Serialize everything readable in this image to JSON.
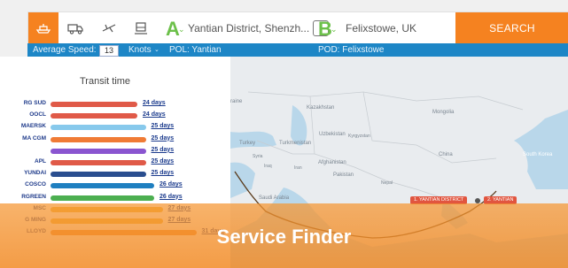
{
  "toolbar": {
    "modes": [
      {
        "icon": "ship-icon",
        "active": true
      },
      {
        "icon": "truck-icon",
        "active": false
      },
      {
        "icon": "plane-icon",
        "active": false
      },
      {
        "icon": "rail-icon",
        "active": false
      }
    ],
    "origin_letter": "A",
    "origin_value": "Yantian District, Shenzh...",
    "destination_letter": "B",
    "destination_value": "Felixstowe, UK",
    "search_label": "SEARCH",
    "accent_color": "#f58220",
    "route_color": "#6cc04a"
  },
  "infobar": {
    "speed_label": "Average Speed:",
    "speed_value": "13",
    "speed_unit": "Knots",
    "pol": "POL: Yantian",
    "pod": "POD: Felixstowe",
    "color": "#1d86c6"
  },
  "transit": {
    "title": "Transit time",
    "rows": [
      {
        "carrier": "RG SUD",
        "days": 24,
        "label": "24 days",
        "color": "#e05a48"
      },
      {
        "carrier": "OOCL",
        "days": 24,
        "label": "24 days",
        "color": "#e05a48"
      },
      {
        "carrier": "MAERSK",
        "days": 25,
        "label": "25 days",
        "color": "#87c9ec"
      },
      {
        "carrier": "MA CGM",
        "days": 25,
        "label": "25 days",
        "color": "#f07b35"
      },
      {
        "carrier": "",
        "days": 25,
        "label": "25 days",
        "color": "#8a55d0"
      },
      {
        "carrier": "APL",
        "days": 25,
        "label": "25 days",
        "color": "#e05a48"
      },
      {
        "carrier": "YUNDAI",
        "days": 25,
        "label": "25 days",
        "color": "#2a4e8f"
      },
      {
        "carrier": "COSCO",
        "days": 26,
        "label": "26 days",
        "color": "#1f7fc0"
      },
      {
        "carrier": "RGREEN",
        "days": 26,
        "label": "26 days",
        "color": "#4caf50"
      },
      {
        "carrier": "MSC",
        "days": 27,
        "label": "27 days",
        "color": "#f0b43a"
      },
      {
        "carrier": "G MING",
        "days": 27,
        "label": "27 days",
        "color": "#f0b43a"
      },
      {
        "carrier": "LLOYD",
        "days": 31,
        "label": "31 days",
        "color": "#f08a30"
      }
    ]
  },
  "map": {
    "labels": [
      "Kazakhstan",
      "Mongolia",
      "Uzbekistan",
      "Kyrgyzstan",
      "Turkey",
      "Turkmenistan",
      "China",
      "Syria",
      "Iraq",
      "Iran",
      "Afghanistan",
      "Pakistan",
      "Nepal",
      "South Korea",
      "Saudi Arabia",
      "raine"
    ],
    "ports": [
      "1. YANTIAN DISTRICT",
      "2. YANTIAN"
    ]
  },
  "banner": {
    "title": "Service Finder"
  }
}
